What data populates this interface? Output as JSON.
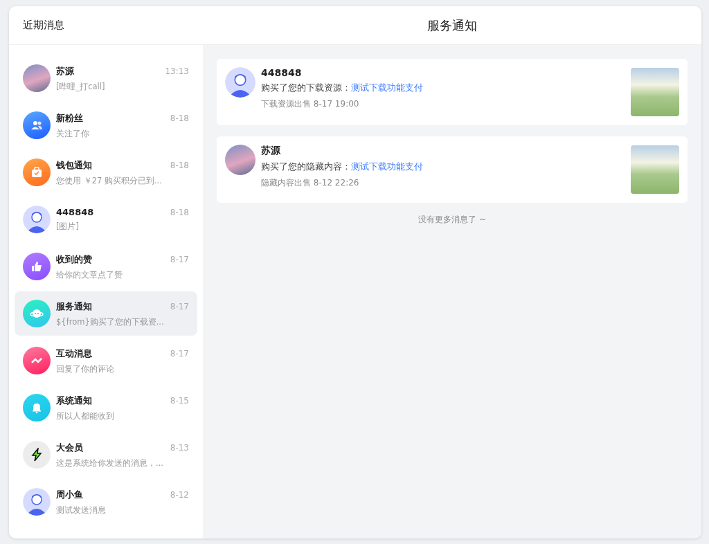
{
  "sidebar": {
    "title": "近期消息",
    "items": [
      {
        "name": "苏源",
        "time": "13:13",
        "preview": "[哔哩_打call]",
        "kind": "photo",
        "selected": false
      },
      {
        "name": "新粉丝",
        "time": "8-18",
        "preview": "关注了你",
        "kind": "fans",
        "selected": false
      },
      {
        "name": "钱包通知",
        "time": "8-18",
        "preview": "您使用 ￥27 购买积分已到...",
        "kind": "wallet",
        "selected": false
      },
      {
        "name": "448848",
        "time": "8-18",
        "preview": "[图片]",
        "kind": "cartoon",
        "selected": false
      },
      {
        "name": "收到的赞",
        "time": "8-17",
        "preview": "给你的文章点了赞",
        "kind": "like",
        "selected": false
      },
      {
        "name": "服务通知",
        "time": "8-17",
        "preview": "${from}购买了您的下载资...",
        "kind": "service",
        "selected": true
      },
      {
        "name": "互动消息",
        "time": "8-17",
        "preview": "回复了你的评论",
        "kind": "interact",
        "selected": false
      },
      {
        "name": "系统通知",
        "time": "8-15",
        "preview": "所以人都能收到",
        "kind": "system",
        "selected": false
      },
      {
        "name": "大会员",
        "time": "8-13",
        "preview": "这是系统给你发送的消息，...",
        "kind": "vip",
        "selected": false
      },
      {
        "name": "周小鱼",
        "time": "8-12",
        "preview": "测试发送消息",
        "kind": "cartoon",
        "selected": false
      }
    ]
  },
  "main": {
    "title": "服务通知",
    "notices": [
      {
        "user": "448848",
        "kind": "cartoon",
        "action": "购买了您的下载资源：",
        "link": "测试下载功能支付",
        "meta": "下载资源出售 8-17 19:00"
      },
      {
        "user": "苏源",
        "kind": "photo",
        "action": "购买了您的隐藏内容：",
        "link": "测试下载功能支付",
        "meta": "隐藏内容出售 8-12 22:26"
      }
    ],
    "end_note": "没有更多消息了 ~"
  }
}
